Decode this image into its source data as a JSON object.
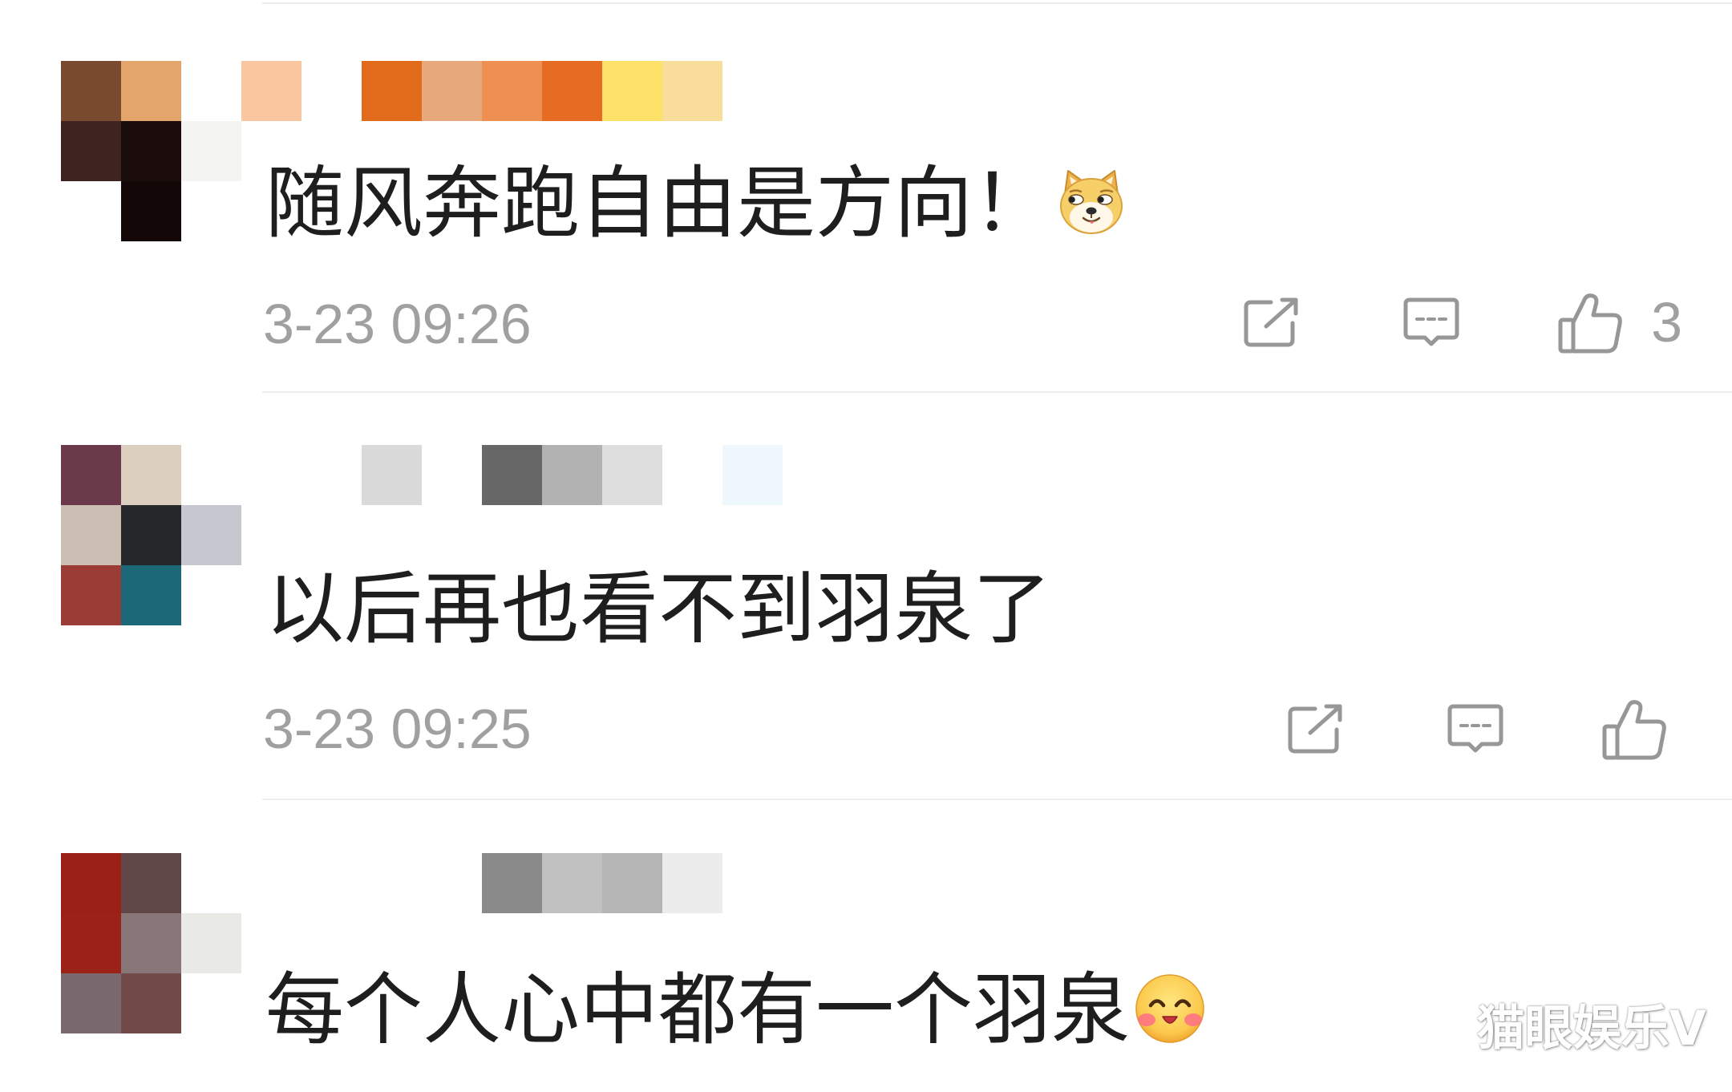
{
  "colors": {
    "text": "#1e1e1e",
    "meta": "#a0a0a0",
    "icon": "#979797",
    "divider": "#ededed",
    "watermark": "#ffffff"
  },
  "icons": {
    "share": "share-icon",
    "reply": "comment-icon",
    "like": "thumbs-up-icon"
  },
  "comments": [
    {
      "avatar_mosaic": [
        "#7a4a2e",
        "#e3a56c",
        "#3e2421",
        "#1a0c0a",
        "#f4f4f1",
        "#140707"
      ],
      "name_mosaic": [
        "#f9c6a0",
        "#e16a1b",
        "#e7a87b",
        "#ed9052",
        "#e66c23",
        "#fde169",
        "#f9dd9a"
      ],
      "text": "随风奔跑自由是方向！",
      "emoji": "doge",
      "time": "3-23 09:26",
      "like_count": "3"
    },
    {
      "avatar_mosaic": [
        "#6b3a4a",
        "#dccfc0",
        "#cabfb2",
        "#25272b",
        "#c6c7cf",
        "#9b3d36",
        "#1c6878"
      ],
      "name_mosaic": [
        "#dadada",
        "#676767",
        "#b2b2b2",
        "#dedede",
        "#eef8fc"
      ],
      "text": "以后再也看不到羽泉了",
      "time": "3-23 09:25"
    },
    {
      "avatar_mosaic": [
        "#9a1f15",
        "#5f4745",
        "#9a2216",
        "#887678",
        "#e9e9e5",
        "#79696f",
        "#724b49"
      ],
      "name_mosaic": [
        "#8a8a8a",
        "#c1c1c1",
        "#b5b5b5",
        "#ececec"
      ],
      "text": "每个人心中都有一个羽泉",
      "emoji": "blush"
    }
  ],
  "watermark": "猫眼娱乐V"
}
